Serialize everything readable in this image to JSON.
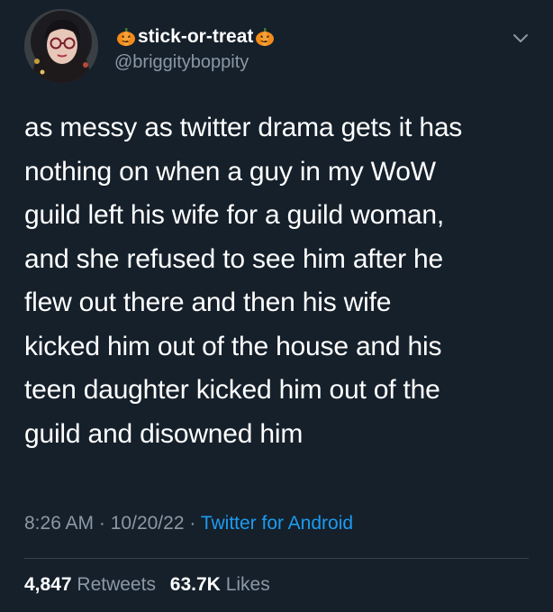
{
  "tweet": {
    "author": {
      "display_name": "stick-or-treat",
      "handle": "@briggityboppity",
      "display_name_emoji": "pumpkin-icon"
    },
    "text": "as messy as twitter drama gets it has\nnothing on when a guy in my WoW\nguild left his wife for a guild woman,\nand she refused to see him after he\nflew out there and then his wife\nkicked him out of the house and his\nteen daughter kicked him out of the\nguild and disowned him",
    "time": "8:26 AM",
    "date": "10/20/22",
    "separator": "·",
    "source": "Twitter for Android",
    "stats": {
      "retweets_count": "4,847",
      "retweets_label": "Retweets",
      "likes_count": "63.7K",
      "likes_label": "Likes"
    }
  },
  "colors": {
    "background": "#15202b",
    "primary_text": "#ffffff",
    "secondary_text": "#8b98a5",
    "link": "#1d9bf0",
    "divider": "#38444d"
  }
}
